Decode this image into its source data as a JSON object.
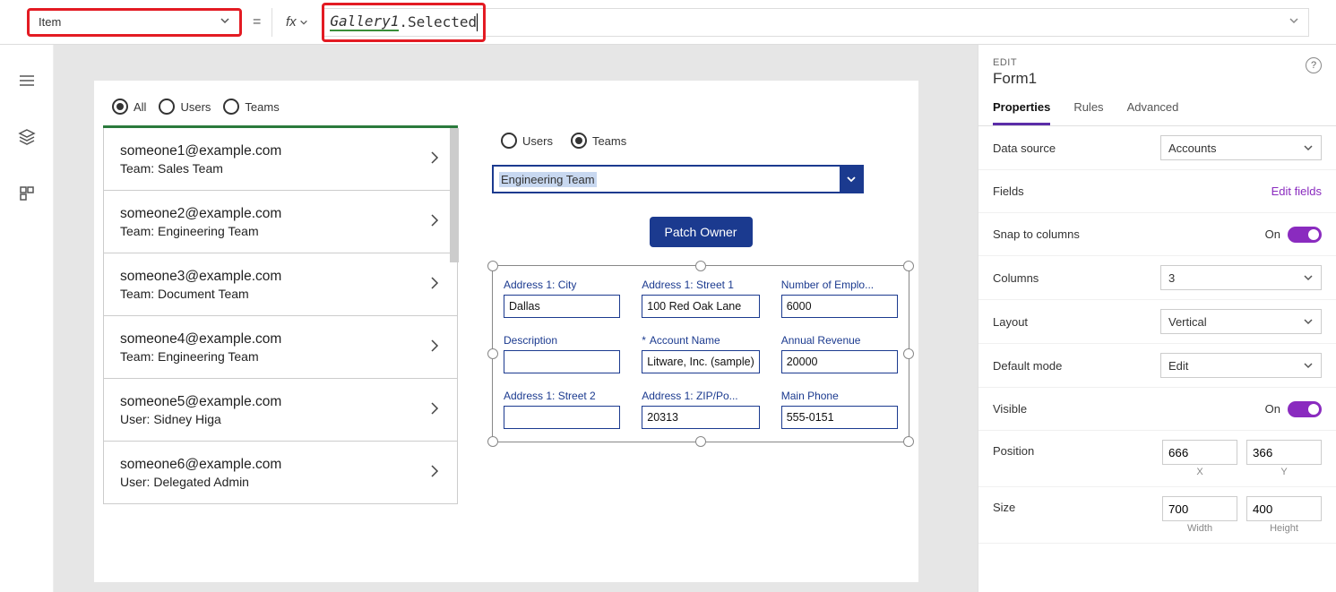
{
  "topbar": {
    "property": "Item",
    "fx": "fx",
    "formula_g": "Gallery1",
    "formula_rest": ".Selected"
  },
  "radios_main": {
    "all": "All",
    "users": "Users",
    "teams": "Teams"
  },
  "gallery": [
    {
      "mail": "someone1@example.com",
      "sub": "Team: Sales Team"
    },
    {
      "mail": "someone2@example.com",
      "sub": "Team: Engineering Team"
    },
    {
      "mail": "someone3@example.com",
      "sub": "Team: Document Team"
    },
    {
      "mail": "someone4@example.com",
      "sub": "Team: Engineering Team"
    },
    {
      "mail": "someone5@example.com",
      "sub": "User: Sidney Higa"
    },
    {
      "mail": "someone6@example.com",
      "sub": "User: Delegated Admin"
    }
  ],
  "radios_form": {
    "users": "Users",
    "teams": "Teams"
  },
  "combo": "Engineering Team",
  "patch": "Patch Owner",
  "form": {
    "f1": {
      "label": "Address 1: City",
      "value": "Dallas"
    },
    "f2": {
      "label": "Address 1: Street 1",
      "value": "100 Red Oak Lane"
    },
    "f3": {
      "label": "Number of Emplo...",
      "value": "6000"
    },
    "f4": {
      "label": "Description",
      "value": ""
    },
    "f5": {
      "label": "Account Name",
      "value": "Litware, Inc. (sample)"
    },
    "f6": {
      "label": "Annual Revenue",
      "value": "20000"
    },
    "f7": {
      "label": "Address 1: Street 2",
      "value": ""
    },
    "f8": {
      "label": "Address 1: ZIP/Po...",
      "value": "20313"
    },
    "f9": {
      "label": "Main Phone",
      "value": "555-0151"
    }
  },
  "panel": {
    "edit": "EDIT",
    "name": "Form1",
    "tabs": {
      "p": "Properties",
      "r": "Rules",
      "a": "Advanced"
    },
    "datasource_lbl": "Data source",
    "datasource_val": "Accounts",
    "fields_lbl": "Fields",
    "fields_link": "Edit fields",
    "snap_lbl": "Snap to columns",
    "on": "On",
    "cols_lbl": "Columns",
    "cols_val": "3",
    "layout_lbl": "Layout",
    "layout_val": "Vertical",
    "mode_lbl": "Default mode",
    "mode_val": "Edit",
    "visible_lbl": "Visible",
    "pos_lbl": "Position",
    "pos_x": "666",
    "pos_y": "366",
    "x": "X",
    "y": "Y",
    "size_lbl": "Size",
    "size_w": "700",
    "size_h": "400",
    "w": "Width",
    "h": "Height"
  }
}
